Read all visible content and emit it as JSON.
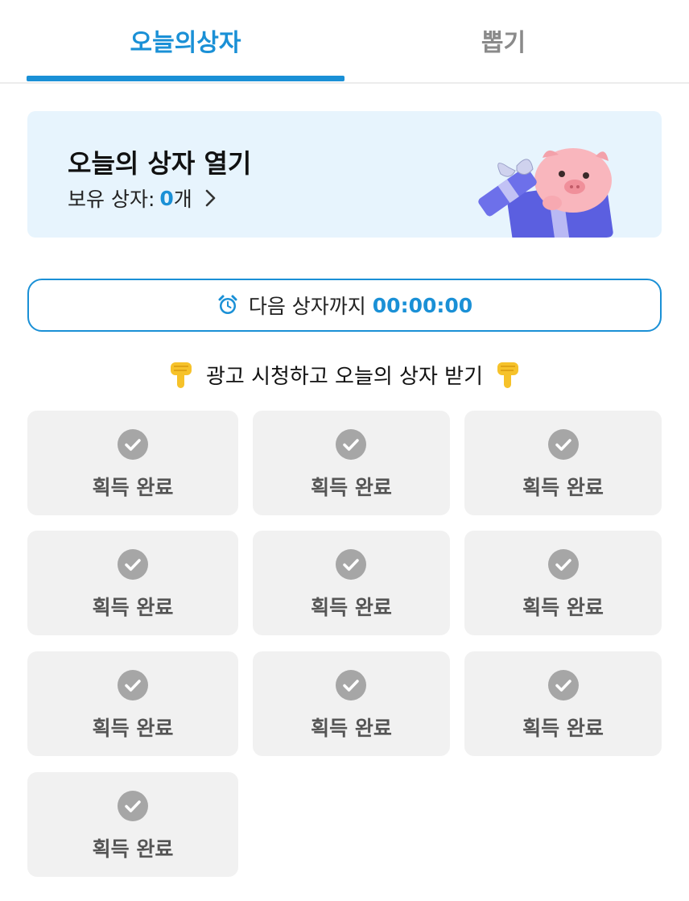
{
  "tabs": [
    {
      "label": "오늘의상자",
      "active": true
    },
    {
      "label": "뽑기",
      "active": false
    }
  ],
  "banner": {
    "title": "오늘의 상자 열기",
    "owned_label": "보유 상자:",
    "owned_count": "0",
    "owned_unit": "개"
  },
  "timer": {
    "label": "다음 상자까지",
    "time": "00:00:00"
  },
  "ad_section": {
    "title": "광고 시청하고 오늘의 상자 받기"
  },
  "boxes": [
    {
      "status": "획득 완료"
    },
    {
      "status": "획득 완료"
    },
    {
      "status": "획득 완료"
    },
    {
      "status": "획득 완료"
    },
    {
      "status": "획득 완료"
    },
    {
      "status": "획득 완료"
    },
    {
      "status": "획득 완료"
    },
    {
      "status": "획득 완료"
    },
    {
      "status": "획득 완료"
    },
    {
      "status": "획득 완료"
    }
  ],
  "colors": {
    "accent": "#1a90d6",
    "banner_bg": "#e7f4fd",
    "box_bg": "#f1f1f1",
    "check": "#a6a6a6"
  }
}
